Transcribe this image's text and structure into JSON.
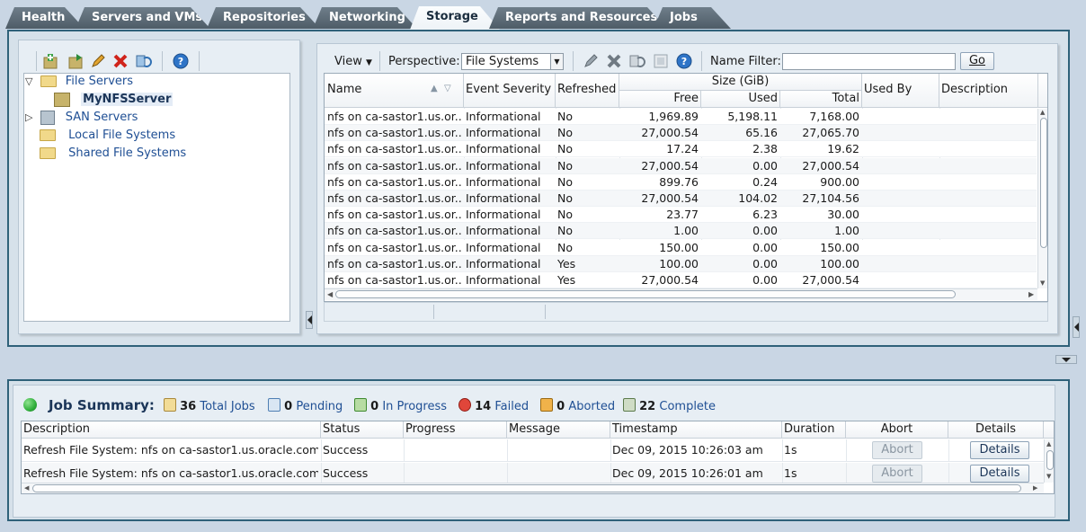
{
  "tabs": [
    {
      "label": "Health",
      "ul": "e"
    },
    {
      "label": "Servers and VMs",
      "ul": "S"
    },
    {
      "label": "Repositories",
      "ul": "R"
    },
    {
      "label": "Networking",
      "ul": "N"
    },
    {
      "label": "Storage",
      "ul": ""
    },
    {
      "label": "Reports and Resources",
      "ul": "o"
    },
    {
      "label": "Jobs",
      "ul": "J"
    }
  ],
  "tree": {
    "file_servers": "File Servers",
    "my_nfs_server": "MyNFSServer",
    "san_servers": "SAN Servers",
    "local_fs": "Local File Systems",
    "shared_fs": "Shared File Systems"
  },
  "toolbar": {
    "view": "View",
    "perspective_label": "Perspective:",
    "perspective_value": "File Systems",
    "name_filter_label": "Name Filter:",
    "name_filter_value": "",
    "go": "Go"
  },
  "grid": {
    "headers": {
      "name": "Name",
      "severity": "Event Severity",
      "refreshed": "Refreshed",
      "size_group": "Size (GiB)",
      "free": "Free",
      "used": "Used",
      "total": "Total",
      "used_by": "Used By",
      "description": "Description"
    },
    "rows": [
      {
        "name": "nfs on ca-sastor1.us.or...",
        "severity": "Informational",
        "refreshed": "No",
        "free": "1,969.89",
        "used": "5,198.11",
        "total": "7,168.00"
      },
      {
        "name": "nfs on ca-sastor1.us.or...",
        "severity": "Informational",
        "refreshed": "No",
        "free": "27,000.54",
        "used": "65.16",
        "total": "27,065.70"
      },
      {
        "name": "nfs on ca-sastor1.us.or...",
        "severity": "Informational",
        "refreshed": "No",
        "free": "17.24",
        "used": "2.38",
        "total": "19.62"
      },
      {
        "name": "nfs on ca-sastor1.us.or...",
        "severity": "Informational",
        "refreshed": "No",
        "free": "27,000.54",
        "used": "0.00",
        "total": "27,000.54"
      },
      {
        "name": "nfs on ca-sastor1.us.or...",
        "severity": "Informational",
        "refreshed": "No",
        "free": "899.76",
        "used": "0.24",
        "total": "900.00"
      },
      {
        "name": "nfs on ca-sastor1.us.or...",
        "severity": "Informational",
        "refreshed": "No",
        "free": "27,000.54",
        "used": "104.02",
        "total": "27,104.56"
      },
      {
        "name": "nfs on ca-sastor1.us.or...",
        "severity": "Informational",
        "refreshed": "No",
        "free": "23.77",
        "used": "6.23",
        "total": "30.00"
      },
      {
        "name": "nfs on ca-sastor1.us.or...",
        "severity": "Informational",
        "refreshed": "No",
        "free": "1.00",
        "used": "0.00",
        "total": "1.00"
      },
      {
        "name": "nfs on ca-sastor1.us.or...",
        "severity": "Informational",
        "refreshed": "No",
        "free": "150.00",
        "used": "0.00",
        "total": "150.00"
      },
      {
        "name": "nfs on ca-sastor1.us.or...",
        "severity": "Informational",
        "refreshed": "Yes",
        "free": "100.00",
        "used": "0.00",
        "total": "100.00"
      },
      {
        "name": "nfs on ca-sastor1.us.or...",
        "severity": "Informational",
        "refreshed": "Yes",
        "free": "27,000.54",
        "used": "0.00",
        "total": "27,000.54"
      }
    ]
  },
  "jobs": {
    "title": "Job Summary:",
    "total_count": "36",
    "total_label": "Total Jobs",
    "pending_count": "0",
    "pending_label": "Pending",
    "inprogress_count": "0",
    "inprogress_label": "In Progress",
    "failed_count": "14",
    "failed_label": "Failed",
    "aborted_count": "0",
    "aborted_label": "Aborted",
    "complete_count": "22",
    "complete_label": "Complete",
    "headers": {
      "description": "Description",
      "status": "Status",
      "progress": "Progress",
      "message": "Message",
      "timestamp": "Timestamp",
      "duration": "Duration",
      "abort": "Abort",
      "details": "Details"
    },
    "rows": [
      {
        "description": "Refresh File System: nfs on ca-sastor1.us.oracle.com...",
        "status": "Success",
        "timestamp": "Dec 09, 2015 10:26:03 am",
        "duration": "1s",
        "abort": "Abort",
        "details": "Details"
      },
      {
        "description": "Refresh File System: nfs on ca-sastor1.us.oracle.com...",
        "status": "Success",
        "timestamp": "Dec 09, 2015 10:26:01 am",
        "duration": "1s",
        "abort": "Abort",
        "details": "Details"
      }
    ]
  },
  "colors": {
    "accent": "#2f6179",
    "link": "#1f4f94",
    "status_green": "#2fae3a"
  }
}
